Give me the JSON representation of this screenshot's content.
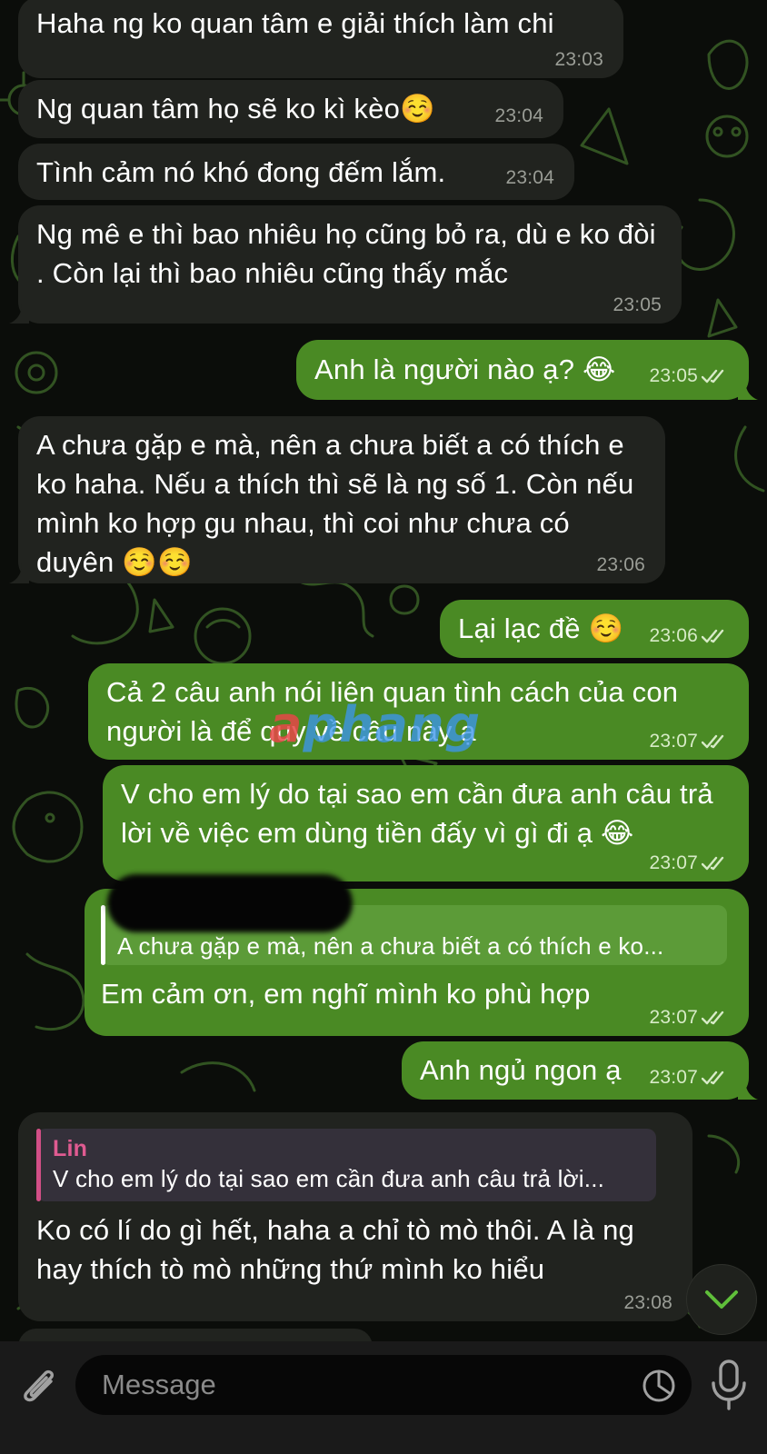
{
  "colors": {
    "incoming_bubble": "#21231f",
    "outgoing_bubble": "#4a8a24",
    "reply_name": "#e05b91",
    "wallpaper_doodle": "#3f6b2a"
  },
  "messages": [
    {
      "text": "Haha ng ko quan tâm e giải thích làm chi",
      "time": "23:03",
      "direction": "in"
    },
    {
      "text": "Ng quan tâm họ sẽ ko kì kèo☺️",
      "time": "23:04",
      "direction": "in"
    },
    {
      "text": "Tình cảm nó khó đong đếm lắm.",
      "time": "23:04",
      "direction": "in"
    },
    {
      "text": "Ng mê e thì bao nhiêu họ cũng bỏ ra, dù e ko đòi . Còn lại thì bao nhiêu cũng thấy mắc",
      "time": "23:05",
      "direction": "in"
    },
    {
      "text": "Anh là người nào ạ? 😂",
      "time": "23:05",
      "direction": "out",
      "status": "read"
    },
    {
      "text": "A chưa gặp e mà, nên a chưa biết a có thích e ko haha. Nếu a thích thì sẽ là ng số 1. Còn nếu mình ko hợp gu nhau, thì coi như chưa có duyên ☺️☺️",
      "time": "23:06",
      "direction": "in"
    },
    {
      "text": "Lại lạc đề ☺️",
      "time": "23:06",
      "direction": "out",
      "status": "read"
    },
    {
      "text": "Cả 2 câu anh nói liên quan tình cách của con người là để quy về câu này ạ",
      "time": "23:07",
      "direction": "out",
      "status": "read"
    },
    {
      "text": "V cho em lý do tại sao em cần đưa anh câu trả lời về việc em dùng tiền đấy vì gì đi ạ 😂",
      "time": "23:07",
      "direction": "out",
      "status": "read"
    },
    {
      "text": "Em cảm ơn, em nghĩ mình ko phù hợp",
      "time": "23:07",
      "direction": "out",
      "status": "read",
      "reply": {
        "text": "A chưa gặp e mà, nên a chưa biết a có thích e ko..."
      }
    },
    {
      "text": "Anh ngủ ngon ạ",
      "time": "23:07",
      "direction": "out",
      "status": "read"
    },
    {
      "text": "Ko có lí do gì hết, haha a chỉ tò mò thôi. A là ng hay thích tò mò những thứ mình ko hiểu",
      "time": "23:08",
      "direction": "in",
      "reply": {
        "name": "Lin",
        "text": "V cho em lý do tại sao em cần đưa anh câu trả lời..."
      }
    }
  ],
  "watermark": {
    "lead": "a",
    "rest": "phang"
  },
  "input": {
    "placeholder": "Message"
  },
  "icons": {
    "attach": "paperclip-icon",
    "sticker": "sticker-icon",
    "mic": "microphone-icon",
    "scroll": "chevron-down-icon",
    "status": "double-check-icon"
  }
}
